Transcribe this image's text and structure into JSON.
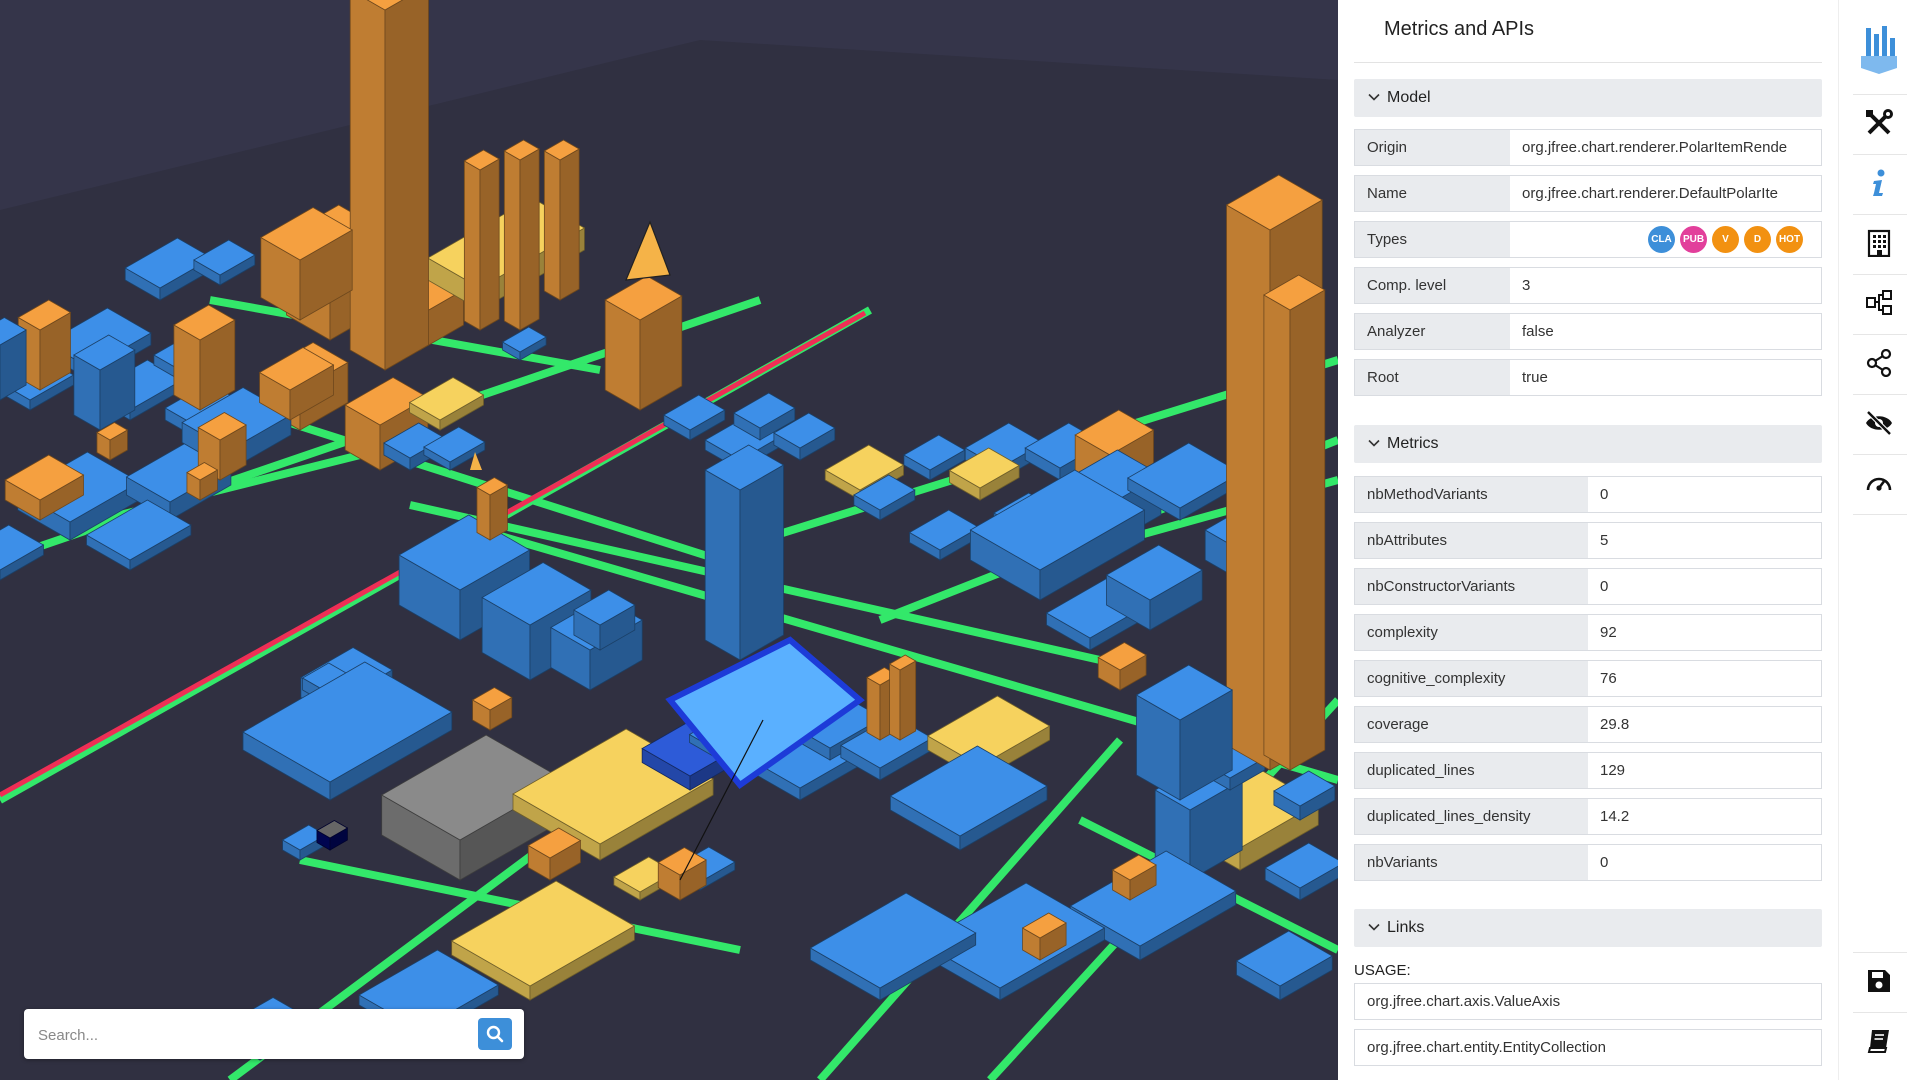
{
  "panel": {
    "title": "Metrics and APIs",
    "model_section": {
      "label": "Model",
      "rows": [
        {
          "key": "Origin",
          "value": "org.jfree.chart.renderer.PolarItemRende"
        },
        {
          "key": "Name",
          "value": "org.jfree.chart.renderer.DefaultPolarIte"
        },
        {
          "key": "Types",
          "value": ""
        },
        {
          "key": "Comp. level",
          "value": "3"
        },
        {
          "key": "Analyzer",
          "value": "false"
        },
        {
          "key": "Root",
          "value": "true"
        }
      ],
      "type_badges": [
        {
          "label": "CLA",
          "color": "#3d8fd9"
        },
        {
          "label": "PUB",
          "color": "#e23f9b"
        },
        {
          "label": "V",
          "color": "#f29111"
        },
        {
          "label": "D",
          "color": "#f29111"
        },
        {
          "label": "HOT",
          "color": "#f29111"
        }
      ]
    },
    "metrics_section": {
      "label": "Metrics",
      "rows": [
        {
          "key": "nbMethodVariants",
          "value": "0"
        },
        {
          "key": "nbAttributes",
          "value": "5"
        },
        {
          "key": "nbConstructorVariants",
          "value": "0"
        },
        {
          "key": "complexity",
          "value": "92"
        },
        {
          "key": "cognitive_complexity",
          "value": "76"
        },
        {
          "key": "coverage",
          "value": "29.8"
        },
        {
          "key": "duplicated_lines",
          "value": "129"
        },
        {
          "key": "duplicated_lines_density",
          "value": "14.2"
        },
        {
          "key": "nbVariants",
          "value": "0"
        }
      ]
    },
    "links_section": {
      "label": "Links",
      "usage_label": "USAGE:",
      "usage": [
        "org.jfree.chart.axis.ValueAxis",
        "org.jfree.chart.entity.EntityCollection"
      ]
    }
  },
  "search": {
    "placeholder": "Search..."
  },
  "toolbar": {
    "tools": [
      {
        "name": "logo-icon"
      },
      {
        "name": "tools-icon"
      },
      {
        "name": "info-icon"
      },
      {
        "name": "building-icon"
      },
      {
        "name": "hierarchy-icon"
      },
      {
        "name": "share-icon"
      },
      {
        "name": "eye-slash-icon"
      },
      {
        "name": "gauge-icon"
      },
      {
        "name": "save-icon"
      },
      {
        "name": "book-icon"
      }
    ]
  },
  "colors": {
    "scene_background": "#303041",
    "building_blue": "#3d8fe8",
    "building_orange": "#f5a040",
    "building_yellow": "#f6d25e",
    "street_green": "#33e86a",
    "street_red": "#ef2e55",
    "selected": "#5ab0ff",
    "accent": "#3d8fd9"
  }
}
